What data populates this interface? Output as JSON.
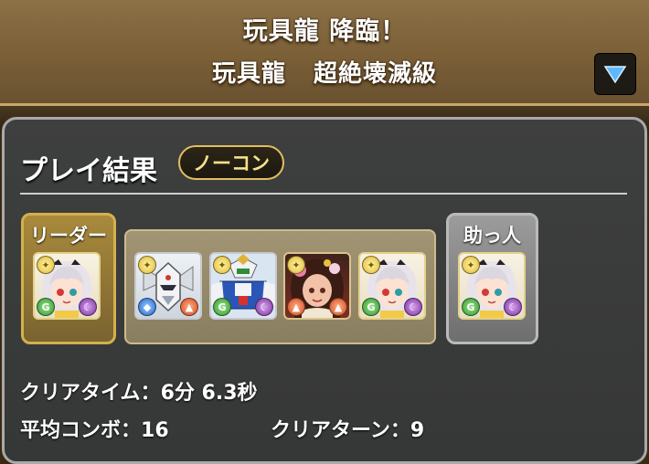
{
  "header": {
    "title": "玩具龍 降臨！",
    "subtitle_left": "玩具龍",
    "subtitle_right": "超絶壊滅級",
    "dropdown_icon": "triangle-down-icon"
  },
  "result": {
    "title": "プレイ結果",
    "badge": "ノーコン"
  },
  "team": {
    "leader_label": "リーダー",
    "helper_label": "助っ人",
    "leader": {
      "icon": "maid-girl-portrait",
      "attributes": [
        "light",
        "wood",
        "dark"
      ]
    },
    "members": [
      {
        "icon": "mecha-robot-portrait",
        "attributes": [
          "light",
          "water",
          "fire"
        ]
      },
      {
        "icon": "gundam-portrait",
        "attributes": [
          "light",
          "wood",
          "dark"
        ]
      },
      {
        "icon": "flower-girl-portrait",
        "attributes": [
          "light",
          "fire",
          "fire"
        ]
      },
      {
        "icon": "maid-girl-portrait",
        "attributes": [
          "light",
          "wood",
          "dark"
        ]
      }
    ],
    "helper": {
      "icon": "maid-girl-portrait",
      "attributes": [
        "light",
        "wood",
        "dark"
      ]
    }
  },
  "stats": {
    "clear_time_label": "クリアタイム：",
    "clear_time_value": "6分 6.3秒",
    "avg_combo_label": "平均コンボ：",
    "avg_combo_value": "16",
    "clear_turn_label": "クリアターン：",
    "clear_turn_value": "9"
  },
  "colors": {
    "header_bg": "#7a5f37",
    "panel_bg": "#3a3b3b",
    "leader_frame": "#d3b14b",
    "badge_text": "#f6e28a"
  }
}
